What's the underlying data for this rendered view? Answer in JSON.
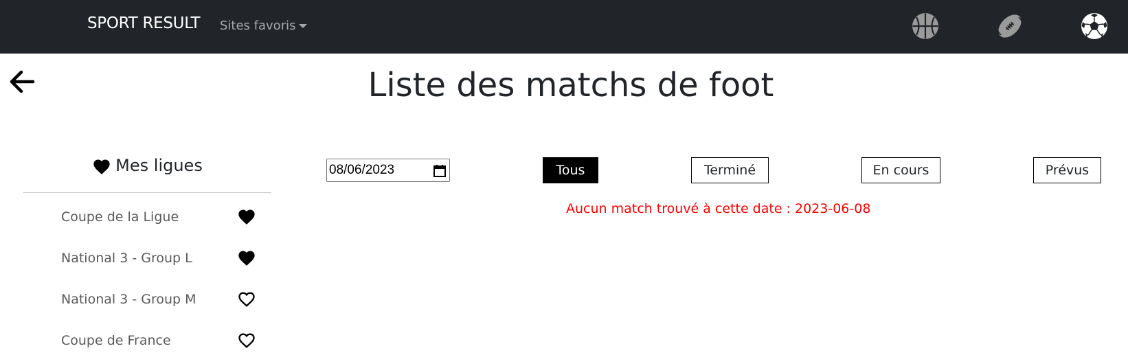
{
  "navbar": {
    "brand": "SPORT RESULT",
    "favorites_menu": "Sites favoris",
    "sport_icons": [
      {
        "icon": "basketball-icon",
        "active": false
      },
      {
        "icon": "american-football-icon",
        "active": false
      },
      {
        "icon": "soccer-ball-icon",
        "active": true
      }
    ]
  },
  "page": {
    "title": "Liste des matchs de foot"
  },
  "sidebar": {
    "heading": "Mes ligues",
    "leagues": [
      {
        "name": "Coupe de la Ligue",
        "favorite": true
      },
      {
        "name": "National 3 - Group L",
        "favorite": true
      },
      {
        "name": "National 3 - Group M",
        "favorite": false
      },
      {
        "name": "Coupe de France",
        "favorite": false
      }
    ]
  },
  "filters": {
    "date_value": "08/06/2023",
    "buttons": [
      {
        "label": "Tous",
        "active": true
      },
      {
        "label": "Terminé",
        "active": false
      },
      {
        "label": "En cours",
        "active": false
      },
      {
        "label": "Prévus",
        "active": false
      }
    ]
  },
  "message": {
    "text": "Aucun match trouvé à cette date : 2023-06-08",
    "color": "#ff0000"
  },
  "colors": {
    "navbar_bg": "#212529",
    "icon_inactive": "#9a9a9a",
    "icon_active": "#ffffff"
  }
}
